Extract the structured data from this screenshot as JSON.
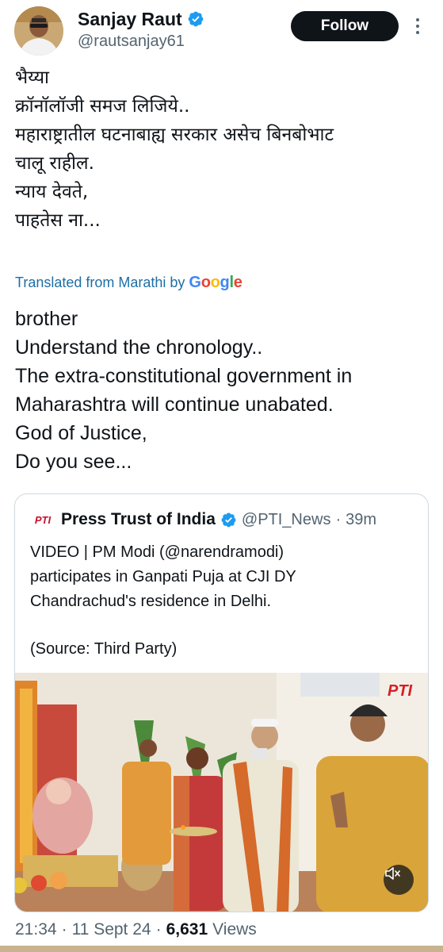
{
  "author": {
    "display_name": "Sanjay Raut",
    "handle": "@rautsanjay61",
    "follow_label": "Follow"
  },
  "tweet": {
    "lines": [
      "भैय्या",
      "क्रॉनॉलॉजी समज लिजिये..",
      "महाराष्ट्रातील घटनाबाह्य सरकार असेच बिनबोभाट",
      "चालू राहील.",
      "न्याय देवते,",
      "पाहतेस ना..."
    ],
    "translated_label": "Translated from Marathi",
    "translated_by": "by",
    "translator": "Google",
    "translation_lines": [
      "brother",
      "Understand the chronology..",
      "The extra-constitutional government in",
      "Maharashtra will continue unabated.",
      "God of Justice,",
      "Do you see..."
    ]
  },
  "quote": {
    "logo_text": "PTI",
    "display_name": "Press Trust of India",
    "handle": "@PTI_News",
    "time": "39m",
    "text_lines": [
      "VIDEO | PM Modi (@narendramodi)",
      "participates in Ganpati Puja at CJI DY",
      "Chandrachud's residence in Delhi."
    ],
    "source": "(Source: Third Party)",
    "watermark": "PTI"
  },
  "meta": {
    "time": "21:34",
    "date": "11 Sept 24",
    "views_count": "6,631",
    "views_label": "Views"
  },
  "colors": {
    "verified": "#1d9bf0",
    "text": "#0f1419",
    "muted": "#536471",
    "link": "#1d6fa5"
  }
}
